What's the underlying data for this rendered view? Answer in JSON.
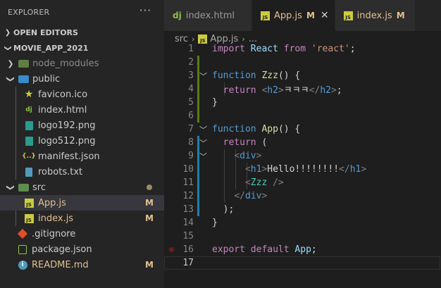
{
  "explorer": {
    "title": "EXPLORER",
    "more_glyph": "···",
    "open_editors_label": "OPEN EDITORS",
    "project_label": "MOVIE_APP_2021",
    "tree": [
      {
        "name": "node_modules",
        "kind": "folder",
        "depth": 1,
        "collapsed": true,
        "dim": true,
        "icon": "node-folder-icon"
      },
      {
        "name": "public",
        "kind": "folder",
        "depth": 1,
        "collapsed": false,
        "icon": "globe-folder-icon"
      },
      {
        "name": "favicon.ico",
        "kind": "file",
        "depth": 2,
        "icon": "star-icon"
      },
      {
        "name": "index.html",
        "kind": "file",
        "depth": 2,
        "icon": "django-icon"
      },
      {
        "name": "logo192.png",
        "kind": "file",
        "depth": 2,
        "icon": "image-icon"
      },
      {
        "name": "logo512.png",
        "kind": "file",
        "depth": 2,
        "icon": "image-icon"
      },
      {
        "name": "manifest.json",
        "kind": "file",
        "depth": 2,
        "icon": "json-icon"
      },
      {
        "name": "robots.txt",
        "kind": "file",
        "depth": 2,
        "icon": "doc-icon"
      },
      {
        "name": "src",
        "kind": "folder",
        "depth": 1,
        "collapsed": false,
        "icon": "src-folder-icon",
        "dot": true
      },
      {
        "name": "App.js",
        "kind": "file",
        "depth": 2,
        "icon": "js-icon",
        "modified": true,
        "badge": "M",
        "selected": true
      },
      {
        "name": "index.js",
        "kind": "file",
        "depth": 2,
        "icon": "js-icon",
        "modified": true,
        "badge": "M"
      },
      {
        "name": ".gitignore",
        "kind": "file",
        "depth": 1,
        "icon": "git-icon"
      },
      {
        "name": "package.json",
        "kind": "file",
        "depth": 1,
        "icon": "node-icon"
      },
      {
        "name": "README.md",
        "kind": "file",
        "depth": 1,
        "icon": "info-icon",
        "badge": "M"
      }
    ]
  },
  "tabs": [
    {
      "label": "index.html",
      "icon": "django-icon",
      "active": false,
      "modified": false,
      "badge": ""
    },
    {
      "label": "App.js",
      "icon": "js-icon",
      "active": true,
      "modified": true,
      "badge": "M",
      "close": "✕"
    },
    {
      "label": "index.js",
      "icon": "js-icon",
      "active": false,
      "modified": true,
      "badge": "M"
    }
  ],
  "breadcrumb": {
    "folder": "src",
    "sep": "›",
    "file": "App.js",
    "ellipsis": "..."
  },
  "code": {
    "current_line": 17,
    "breakpoint_line": 16,
    "lines": [
      {
        "n": "1",
        "fold": ""
      },
      {
        "n": "2",
        "fold": ""
      },
      {
        "n": "3",
        "fold": "﹀"
      },
      {
        "n": "4",
        "fold": ""
      },
      {
        "n": "5",
        "fold": ""
      },
      {
        "n": "6",
        "fold": ""
      },
      {
        "n": "7",
        "fold": "﹀"
      },
      {
        "n": "8",
        "fold": "﹀"
      },
      {
        "n": "9",
        "fold": "﹀"
      },
      {
        "n": "10",
        "fold": ""
      },
      {
        "n": "11",
        "fold": ""
      },
      {
        "n": "12",
        "fold": ""
      },
      {
        "n": "13",
        "fold": ""
      },
      {
        "n": "14",
        "fold": ""
      },
      {
        "n": "15",
        "fold": ""
      },
      {
        "n": "16",
        "fold": ""
      },
      {
        "n": "17",
        "fold": ""
      }
    ],
    "tokens": {
      "l1_import": "import",
      "l1_react": "React",
      "l1_from": "from",
      "l1_str": "'react'",
      "l1_semi": ";",
      "l3_function": "function",
      "l3_name": "Zzz",
      "l3_rest": "() {",
      "l4_return": "return",
      "l4_open_lt": "<",
      "l4_open_tag": "h2",
      "l4_open_gt": ">",
      "l4_text": "ㅋㅋㅋ",
      "l4_close_lt": "</",
      "l4_close_tag": "h2",
      "l4_close_gt": ">",
      "l4_semi": ";",
      "l5": "}",
      "l7_function": "function",
      "l7_name": "App",
      "l7_rest": "() {",
      "l8_return": "return",
      "l8_rest": " (",
      "l9_lt": "<",
      "l9_tag": "div",
      "l9_gt": ">",
      "l10_lt": "<",
      "l10_tag": "h1",
      "l10_gt": ">",
      "l10_text": "Hello!!!!!!!!",
      "l10_clt": "</",
      "l10_ctag": "h1",
      "l10_cgt": ">",
      "l11_lt": "<",
      "l11_comp": "Zzz",
      "l11_end": " />",
      "l12_lt": "</",
      "l12_tag": "div",
      "l12_gt": ">",
      "l13": ");",
      "l14": "}",
      "l16_export": "export",
      "l16_default": "default",
      "l16_app": "App",
      "l16_semi": ";"
    }
  },
  "colors": {
    "modified": "#e2c08d",
    "added_bar": "#587c0c",
    "modified_bar": "#1b81a8"
  }
}
